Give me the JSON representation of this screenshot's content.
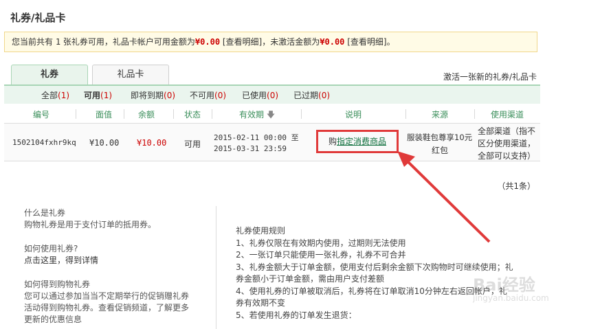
{
  "page": {
    "title": "礼券/礼品卡"
  },
  "notice": {
    "prefix": "您当前共有",
    "count": "1",
    "mid1": "张礼券可用，礼品卡帐户可用金额为",
    "amount1": "¥0.00",
    "detail_link1": "[查看明细]",
    "mid2": "，未激活金额为",
    "amount2": "¥0.00",
    "detail_link2": "[查看明细]",
    "suffix": "。"
  },
  "tabs": [
    {
      "label": "礼券",
      "active": true
    },
    {
      "label": "礼品卡",
      "active": false
    }
  ],
  "activate_link": "激活一张新的礼券/礼品卡",
  "filters": [
    {
      "label": "全部",
      "count": "(1)",
      "active": false
    },
    {
      "label": "可用",
      "count": "(1)",
      "active": true
    },
    {
      "label": "即将到期",
      "count": "(0)",
      "active": false
    },
    {
      "label": "不可用",
      "count": "(0)",
      "active": false
    },
    {
      "label": "已使用",
      "count": "(0)",
      "active": false
    },
    {
      "label": "已过期",
      "count": "(0)",
      "active": false
    }
  ],
  "table": {
    "headers": [
      "编号",
      "面值",
      "余额",
      "状态",
      "有效期",
      "说明",
      "来源",
      "使用渠道"
    ],
    "sort_icon": "arrow-down-icon",
    "rows": [
      {
        "id": "1502104fxhr9kq",
        "face_value": "¥10.00",
        "balance": "¥10.00",
        "status": "可用",
        "valid_from": "2015-02-11 00:00 至",
        "valid_to": "2015-03-31 23:59",
        "desc_prefix": "购",
        "desc_link": "指定消费商品",
        "source_line1": "服装鞋包尊享10元",
        "source_line2": "红包",
        "channel_line1": "全部渠道（指不",
        "channel_line2": "区分使用渠道，",
        "channel_line3": "全部可以支持）"
      }
    ]
  },
  "total": "（共1条）",
  "faq": {
    "q1": "什么是礼券",
    "a1": "购物礼券是用于支付订单的抵用券。",
    "q2": "如何使用礼券?",
    "a2_link": "点击这里，得到详情",
    "q3": "如何得到购物礼券",
    "a3_line1": "您可以通过参加当当不定期举行的促销赠礼券",
    "a3_line2": "活动得到购物礼券。查看促销频道，了解更多",
    "a3_line3": "更新的优惠信息"
  },
  "rules": {
    "title": "礼券使用规则",
    "lines": [
      "1、礼券仅限在有效期内使用，过期则无法使用",
      "2、一张订单只能使用一张礼券，礼券不可合并",
      "3、礼券金额大于订单金额，使用支付后剩余金额下次购物时可继续使用；礼",
      "券金额小于订单金额，需由用户支付差额",
      "4、使用礼券的订单被取消后，礼券将在订单取消10分钟左右返回帐户，礼",
      "券有效期不变",
      "5、若使用礼券的订单发生退货："
    ]
  },
  "annotation": {
    "color": "#e03a3a"
  },
  "watermark": {
    "text": "Bai经验",
    "sub": "jingyan.baidu.com"
  }
}
